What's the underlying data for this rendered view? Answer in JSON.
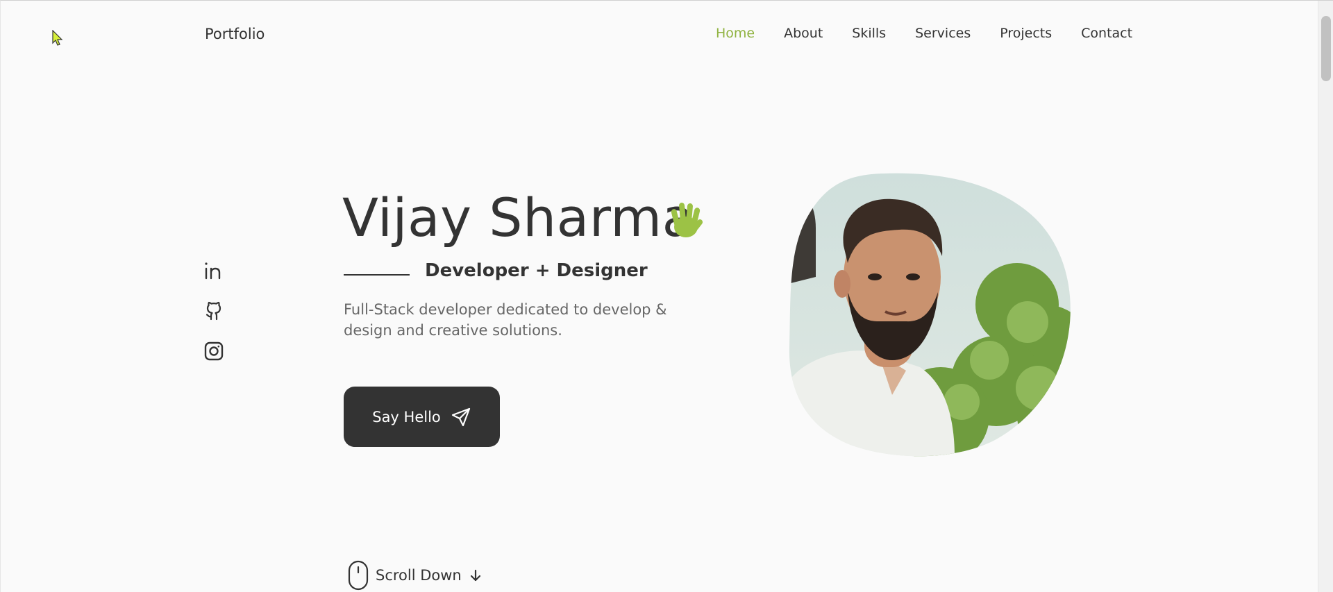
{
  "header": {
    "logo": "Portfolio",
    "nav": [
      {
        "label": "Home",
        "active": true
      },
      {
        "label": "About",
        "active": false
      },
      {
        "label": "Skills",
        "active": false
      },
      {
        "label": "Services",
        "active": false
      },
      {
        "label": "Projects",
        "active": false
      },
      {
        "label": "Contact",
        "active": false
      }
    ]
  },
  "socials": [
    "linkedin-icon",
    "github-icon",
    "instagram-icon"
  ],
  "hero": {
    "name": "Vijay Sharma",
    "subtitle": "Developer + Designer",
    "description": "Full-Stack developer dedicated to develop & design and creative solutions.",
    "cta_label": "Say Hello"
  },
  "scroll": {
    "label": "Scroll Down"
  },
  "colors": {
    "accent": "#8fb23f",
    "text": "#333333",
    "muted": "#666666",
    "background": "#fafafa",
    "button_bg": "#333333"
  }
}
